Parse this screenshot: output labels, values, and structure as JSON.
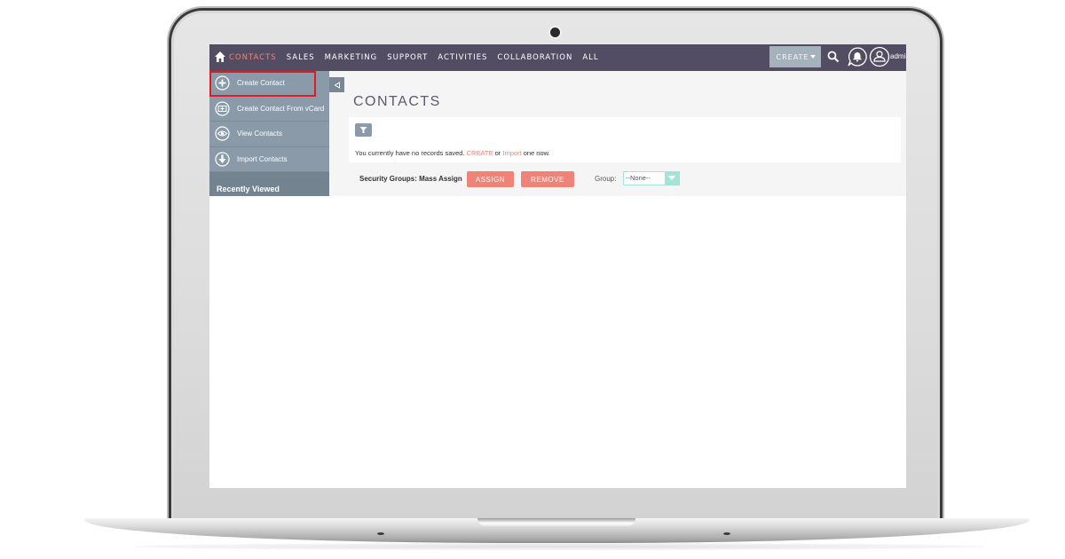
{
  "app": {
    "nav": {
      "items": [
        {
          "label": "CONTACTS",
          "active": true
        },
        {
          "label": "SALES",
          "active": false
        },
        {
          "label": "MARKETING",
          "active": false
        },
        {
          "label": "SUPPORT",
          "active": false
        },
        {
          "label": "ACTIVITIES",
          "active": false
        },
        {
          "label": "COLLABORATION",
          "active": false
        },
        {
          "label": "ALL",
          "active": false
        }
      ],
      "create_label": "CREATE",
      "user_label": "admin"
    },
    "sidebar": {
      "items": [
        {
          "label": "Create Contact",
          "icon": "plus-circle-icon",
          "highlighted": true
        },
        {
          "label": "Create Contact From vCard",
          "icon": "vcard-icon",
          "highlighted": false
        },
        {
          "label": "View Contacts",
          "icon": "eye-icon",
          "highlighted": false
        },
        {
          "label": "Import Contacts",
          "icon": "download-arrow-icon",
          "highlighted": false
        }
      ],
      "recently_viewed_label": "Recently Viewed"
    },
    "main": {
      "title": "CONTACTS",
      "empty_message": {
        "prefix": "You currently have no records saved. ",
        "create_link": "CREATE",
        "middle": " or ",
        "import_link": "Import",
        "suffix": " one now."
      },
      "mass_assign": {
        "label": "Security Groups: Mass Assign",
        "assign_label": "ASSIGN",
        "remove_label": "REMOVE",
        "group_label": "Group:",
        "group_value": "--None--"
      }
    },
    "colors": {
      "navbar": "#534d64",
      "accent": "#f08377",
      "sidebar": "#8a9aa8",
      "highlight_outline": "#e11b22",
      "select_accent": "#a5e3d7"
    }
  }
}
